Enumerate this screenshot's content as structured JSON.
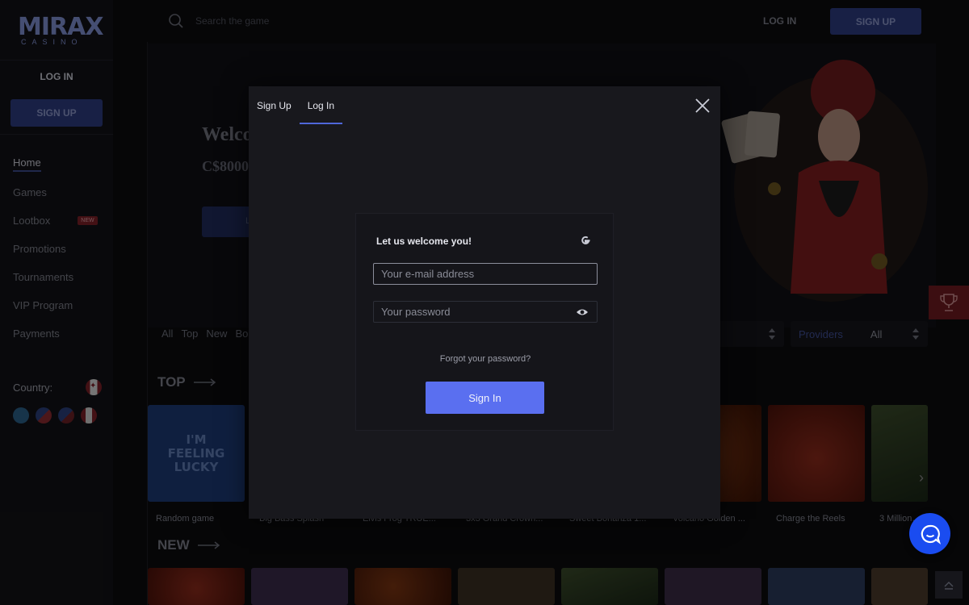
{
  "brand": {
    "logo_word": "MIRAX",
    "logo_sub": "CASINO"
  },
  "sidebar": {
    "login_label": "LOG IN",
    "signup_label": "SIGN UP",
    "nav": [
      {
        "label": "Home"
      },
      {
        "label": "Games"
      },
      {
        "label": "Lootbox",
        "badge": "NEW"
      },
      {
        "label": "Promotions"
      },
      {
        "label": "Tournaments"
      },
      {
        "label": "VIP Program"
      },
      {
        "label": "Payments"
      }
    ],
    "country_label": "Country:"
  },
  "topbar": {
    "search_placeholder": "Search the game",
    "login_label": "LOG IN",
    "signup_label": "SIGN UP"
  },
  "banner": {
    "welcome_partial": "Welco",
    "bonus_partial": "C$8000",
    "button_partial": "L"
  },
  "filters": {
    "tabs": [
      "All",
      "Top",
      "New",
      "Bo"
    ],
    "providers_label": "Providers",
    "providers_value": "All"
  },
  "sections": {
    "top_title": "TOP",
    "new_title": "NEW",
    "lucky_tile_text": "I'M FEELING LUCKY",
    "top_captions": [
      "Random game",
      "Big Bass Splash",
      "Elvis Frog TRUE...",
      "3x3 Grand Crown...",
      "Sweet Bonanza 1...",
      "Volcano Golden ...",
      "Charge the Reels",
      "3 Million ..."
    ]
  },
  "modal": {
    "tab_signup": "Sign Up",
    "tab_login": "Log In",
    "title": "Let us welcome you!",
    "email_placeholder": "Your e-mail address",
    "password_placeholder": "Your password",
    "forgot_label": "Forgot your password?",
    "signin_label": "Sign In"
  },
  "colors": {
    "accent": "#5a6ff0",
    "signup_bg": "#2c3b7f",
    "background": "#0b0b0e",
    "modal_bg": "#18181d",
    "chat": "#1a4cf0"
  }
}
